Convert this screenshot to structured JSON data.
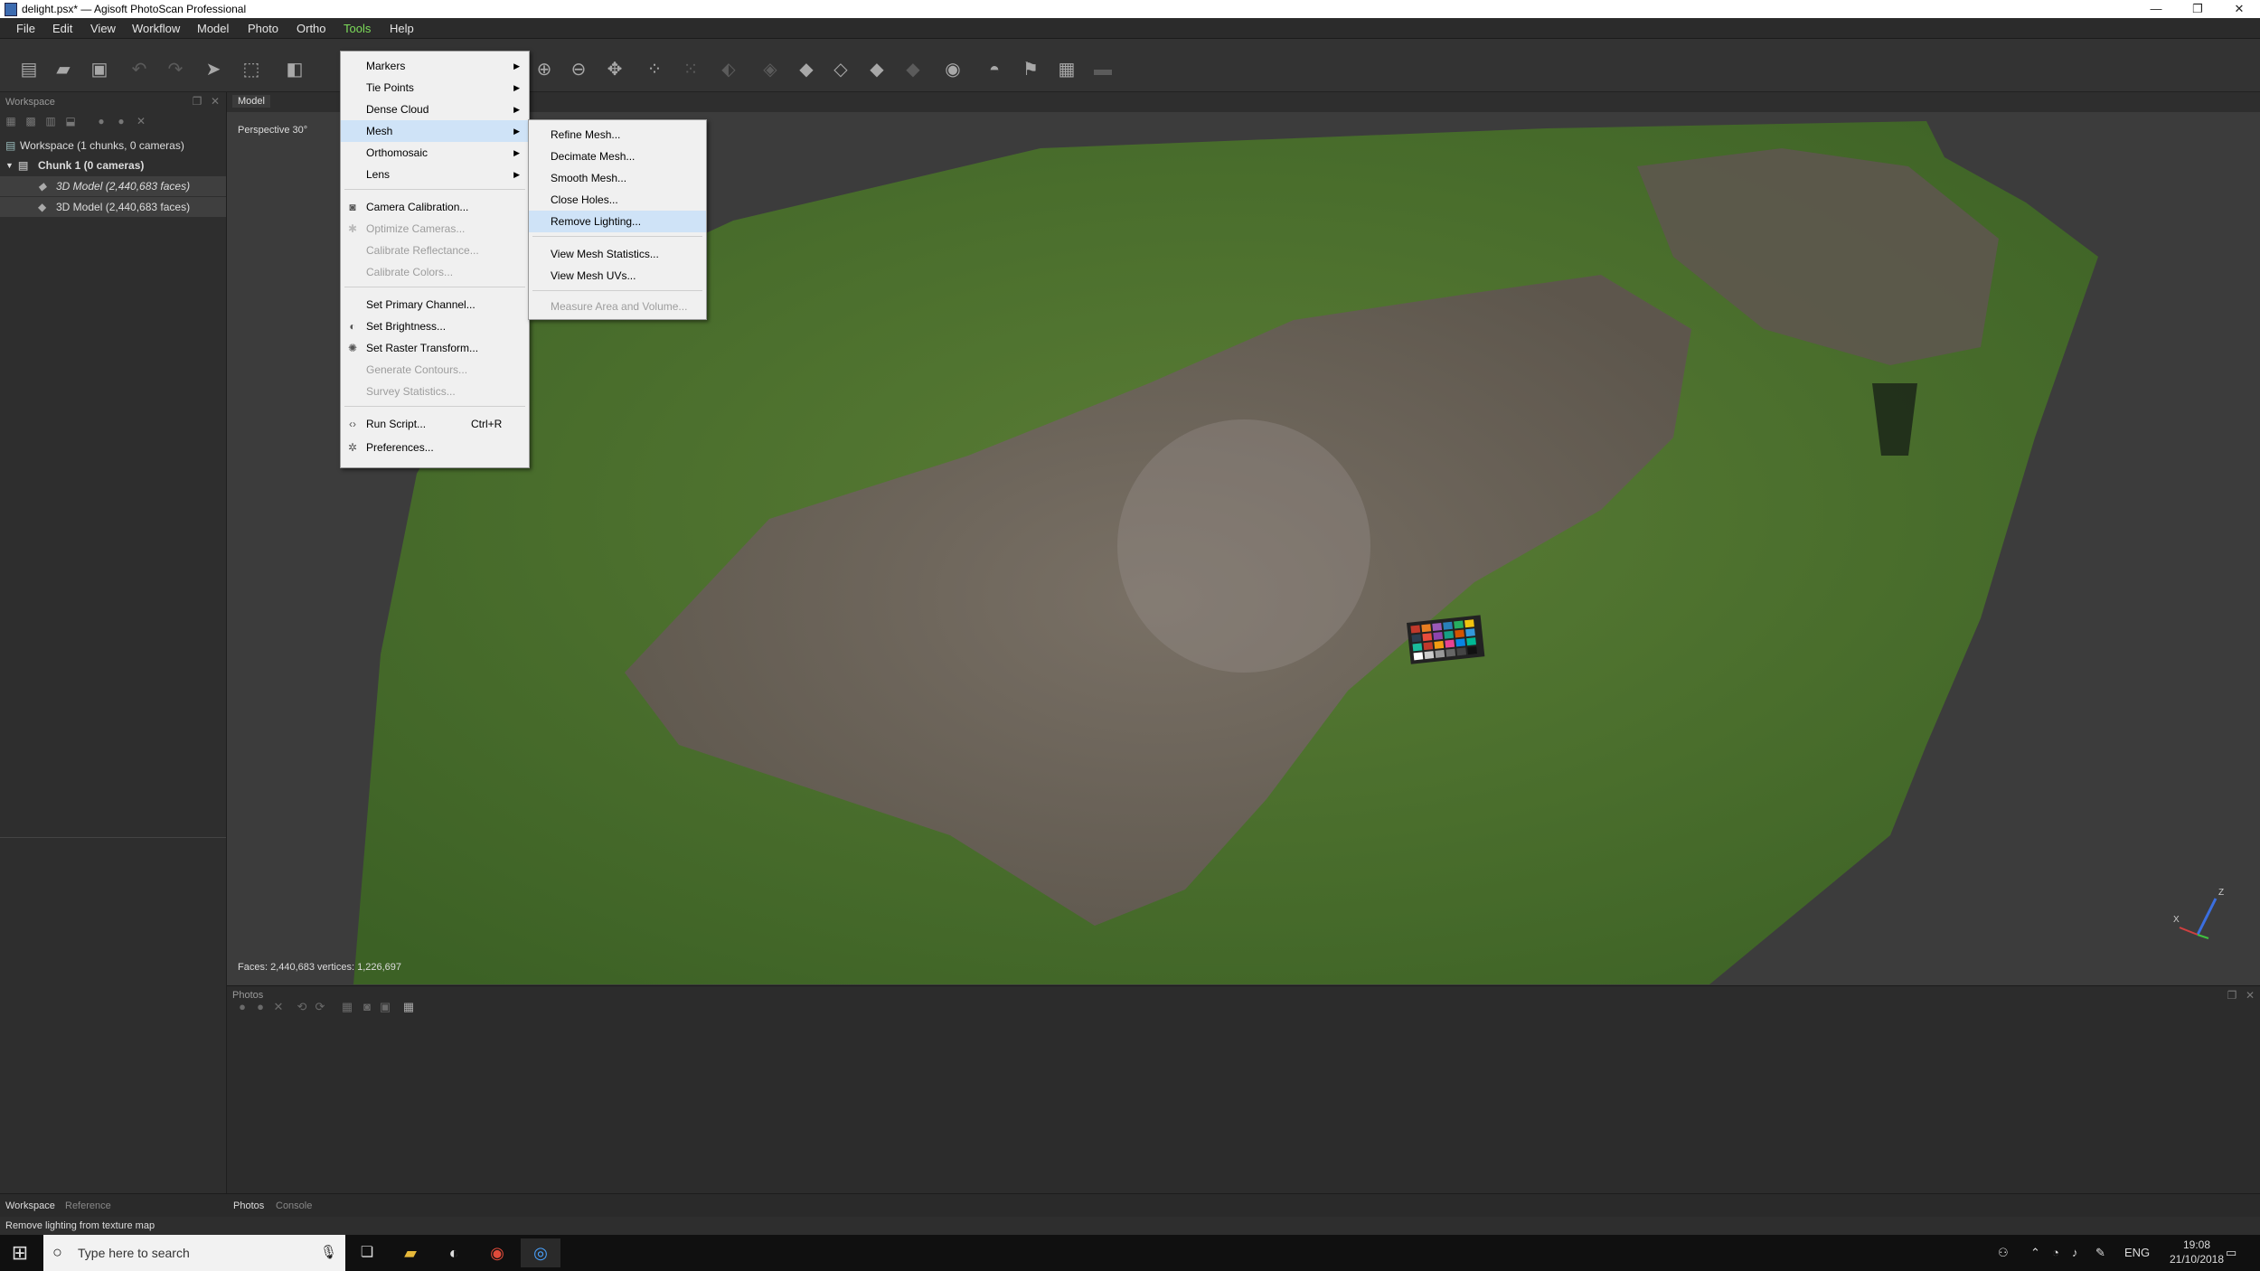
{
  "window": {
    "title": "delight.psx* — Agisoft PhotoScan Professional",
    "controls": {
      "minimize": "—",
      "restore": "❐",
      "close": "✕"
    }
  },
  "menubar": {
    "items": [
      "File",
      "Edit",
      "View",
      "Workflow",
      "Model",
      "Photo",
      "Ortho",
      "Tools",
      "Help"
    ],
    "active": "Tools"
  },
  "workspace": {
    "title": "Workspace",
    "tree": [
      "Workspace (1 chunks, 0 cameras)",
      "Chunk 1 (0 cameras)",
      "3D Model (2,440,683 faces)",
      "3D Model (2,440,683 faces)"
    ]
  },
  "model_view": {
    "tab": "Model",
    "projection": "Perspective 30°",
    "stats": "Faces: 2,440,683 vertices: 1,226,697",
    "axes": {
      "x": "X",
      "z": "Z"
    }
  },
  "photos_pane": {
    "title": "Photos"
  },
  "bottom_tabs": {
    "left": [
      "Workspace",
      "Reference"
    ],
    "right": [
      "Photos",
      "Console"
    ]
  },
  "status": "Remove lighting from texture map",
  "tools_menu": {
    "items": [
      {
        "label": "Markers",
        "submenu": true
      },
      {
        "label": "Tie Points",
        "submenu": true
      },
      {
        "label": "Dense Cloud",
        "submenu": true
      },
      {
        "label": "Mesh",
        "submenu": true,
        "highlighted": true
      },
      {
        "label": "Orthomosaic",
        "submenu": true
      },
      {
        "label": "Lens",
        "submenu": true
      },
      {
        "label": "Camera Calibration...",
        "icon": "camera-icon"
      },
      {
        "label": "Optimize Cameras...",
        "disabled": true
      },
      {
        "label": "Calibrate Reflectance...",
        "disabled": true
      },
      {
        "label": "Calibrate Colors...",
        "disabled": true
      },
      {
        "label": "Set Primary Channel..."
      },
      {
        "label": "Set Brightness...",
        "icon": "brightness-icon"
      },
      {
        "label": "Set Raster Transform...",
        "icon": "raster-icon"
      },
      {
        "label": "Generate Contours...",
        "disabled": true
      },
      {
        "label": "Survey Statistics...",
        "disabled": true
      },
      {
        "label": "Run Script...",
        "shortcut": "Ctrl+R",
        "icon": "script-icon"
      },
      {
        "label": "Preferences...",
        "icon": "preferences-icon"
      }
    ]
  },
  "mesh_submenu": {
    "items": [
      {
        "label": "Refine Mesh..."
      },
      {
        "label": "Decimate Mesh..."
      },
      {
        "label": "Smooth Mesh..."
      },
      {
        "label": "Close Holes..."
      },
      {
        "label": "Remove Lighting...",
        "highlighted": true
      },
      {
        "label": "View Mesh Statistics..."
      },
      {
        "label": "View Mesh UVs..."
      },
      {
        "label": "Measure Area and Volume...",
        "disabled": true
      }
    ]
  },
  "taskbar": {
    "search_placeholder": "Type here to search",
    "language": "ENG",
    "time": "19:08",
    "date": "21/10/2018"
  },
  "colors": {
    "accent_menu": "#7ddc5a",
    "highlight": "#cfe3f7",
    "grass": "#4f7a2f",
    "rock": "#6e6259"
  }
}
